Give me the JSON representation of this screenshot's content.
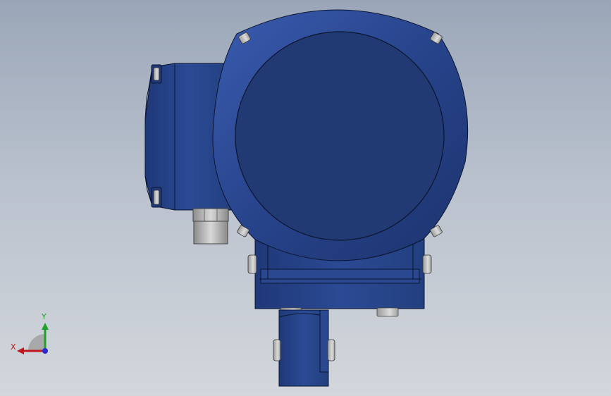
{
  "viewport": {
    "background_top": "#9aa6b8",
    "background_bottom": "#d3d7dc"
  },
  "model": {
    "body_color": "#243f80",
    "face_color": "#213a73",
    "edge_color": "#0b1530",
    "fastener_color": "#b8b8b8"
  },
  "triad": {
    "x_label": "X",
    "y_label": "Y",
    "x_color": "#c0161c",
    "y_color": "#1fa12a",
    "z_color": "#2a2ad0"
  }
}
